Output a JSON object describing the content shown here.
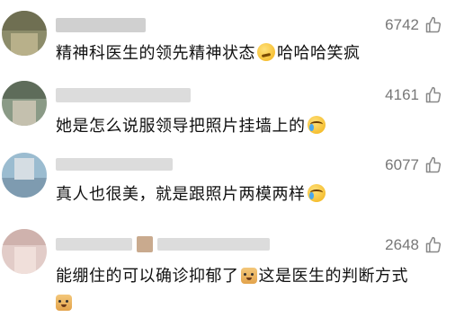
{
  "comments": [
    {
      "likes": "6742",
      "text_before": "精神科医生的领先精神状态",
      "emoji": "thinking-emoji",
      "text_after": "哈哈哈笑疯"
    },
    {
      "likes": "4161",
      "text_before": "她是怎么说服领导把照片挂墙上的",
      "emoji": "laugh-cry-emoji",
      "text_after": ""
    },
    {
      "likes": "6077",
      "text_before": "真人也很美，就是跟照片两模两样",
      "emoji": "laugh-cry-emoji",
      "text_after": ""
    },
    {
      "likes": "2648",
      "text_before": "能绷住的可以确诊抑郁了",
      "emoji": "doge-emoji",
      "text_after": "这是医生的判断方式",
      "trailing_emoji": "doge-emoji"
    }
  ],
  "colors": {
    "text": "#111111",
    "likes": "#777777",
    "blur": "#dcdcdc"
  }
}
